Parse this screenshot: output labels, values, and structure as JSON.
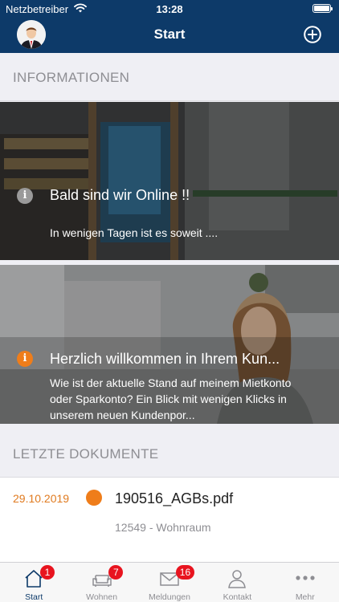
{
  "status_bar": {
    "carrier": "Netzbetreiber",
    "time": "13:28"
  },
  "nav": {
    "title": "Start"
  },
  "sections": {
    "info_header": "INFORMATIONEN",
    "docs_header": "LETZTE DOKUMENTE"
  },
  "info_cards": [
    {
      "title": "Bald sind wir Online !!",
      "body": "In wenigen Tagen ist es soweit ....",
      "icon_color": "#9a9a9a"
    },
    {
      "title": "Herzlich willkommen in Ihrem Kun...",
      "body": "Wie ist der aktuelle Stand auf meinem Mietkonto oder Sparkonto? Ein Blick mit wenigen Klicks in unserem neuen Kundenpor...",
      "icon_color": "#ef7d1a"
    }
  ],
  "documents": [
    {
      "date": "29.10.2019",
      "name": "190516_AGBs.pdf",
      "subtitle": "12549 - Wohnraum"
    }
  ],
  "tabs": [
    {
      "label": "Start",
      "icon": "home-icon",
      "badge": "1",
      "active": true
    },
    {
      "label": "Wohnen",
      "icon": "sofa-icon",
      "badge": "7",
      "active": false
    },
    {
      "label": "Meldungen",
      "icon": "envelope-icon",
      "badge": "16",
      "active": false
    },
    {
      "label": "Kontakt",
      "icon": "person-icon",
      "badge": "",
      "active": false
    },
    {
      "label": "Mehr",
      "icon": "more-icon",
      "badge": "",
      "active": false
    }
  ],
  "colors": {
    "brand": "#0d3a69",
    "accent": "#ef7d1a",
    "badge": "#e8141f"
  }
}
